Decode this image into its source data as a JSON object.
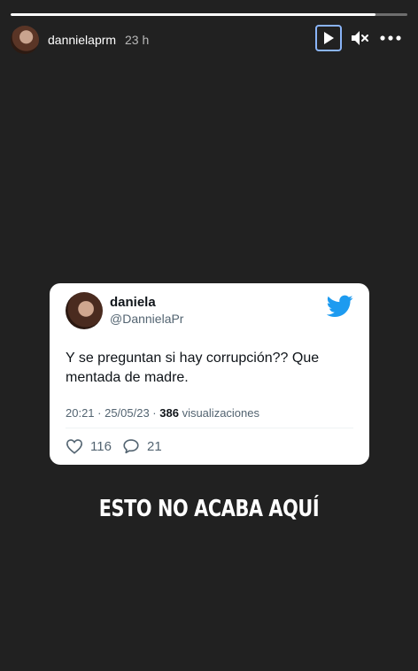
{
  "story": {
    "progress": 0.92,
    "username": "dannielaprm",
    "time": "23 h",
    "icons": {
      "play": "play-icon",
      "mute": "volume-mute-icon",
      "more": "more-dots-icon"
    }
  },
  "tweet": {
    "name": "daniela",
    "handle": "@DannielaPr",
    "text": "Y se preguntan si hay corrupción?? Que mentada de madre.",
    "time_date": "20:21 · 25/05/23 · ",
    "views_count": "386",
    "views_label": " visualizaciones",
    "likes": "116",
    "replies": "21",
    "brand_color": "#1d9bf0"
  },
  "caption": "ESTO NO ACABA AQUÍ"
}
